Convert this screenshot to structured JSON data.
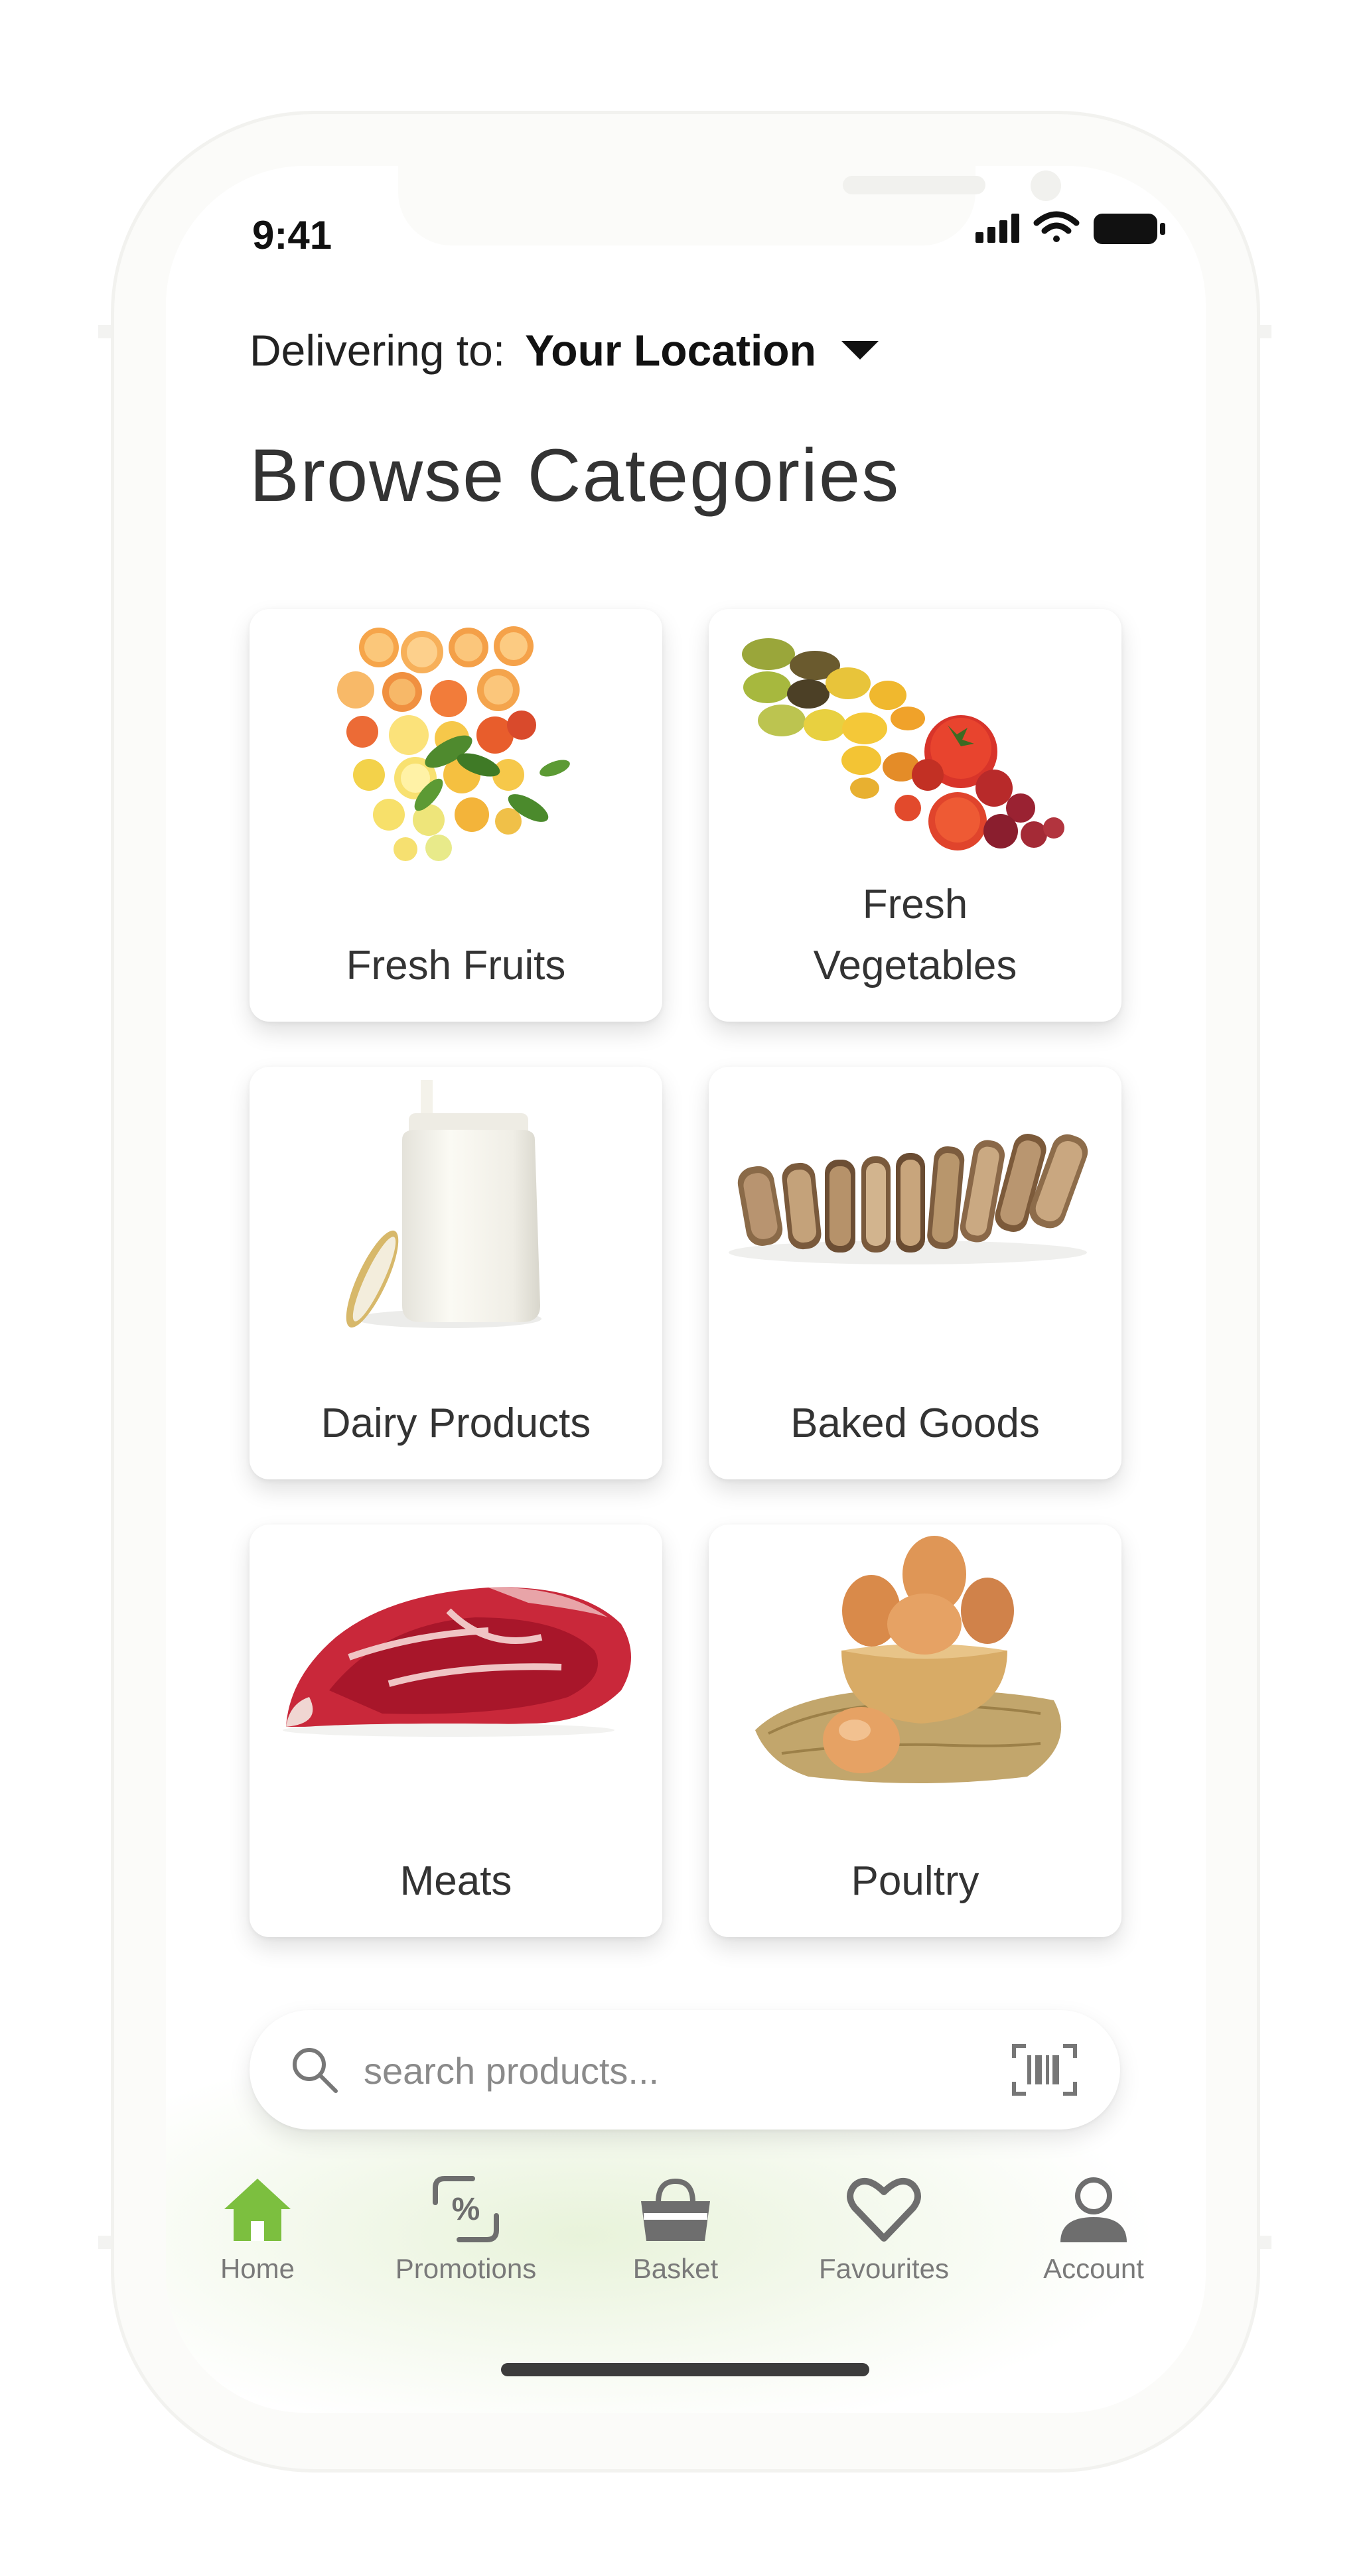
{
  "status_bar": {
    "time": "9:41"
  },
  "delivery": {
    "prefix": "Delivering to:",
    "location": "Your Location"
  },
  "page_title": "Browse Categories",
  "categories": [
    {
      "label": "Fresh Fruits",
      "icon": "citrus-fruits-image"
    },
    {
      "label": "Fresh\nVegetables",
      "icon": "tomatoes-vegetables-image"
    },
    {
      "label": "Dairy Products",
      "icon": "milk-jar-image"
    },
    {
      "label": "Baked Goods",
      "icon": "bread-loaf-image"
    },
    {
      "label": "Meats",
      "icon": "beef-steak-image"
    },
    {
      "label": "Poultry",
      "icon": "eggs-bowl-image"
    }
  ],
  "search": {
    "placeholder": "search products..."
  },
  "nav": {
    "items": [
      {
        "label": "Home",
        "icon": "home-icon",
        "active": true
      },
      {
        "label": "Promotions",
        "icon": "promotions-icon"
      },
      {
        "label": "Basket",
        "icon": "basket-icon"
      },
      {
        "label": "Favourites",
        "icon": "heart-icon"
      },
      {
        "label": "Account",
        "icon": "account-icon"
      }
    ]
  },
  "colors": {
    "accent": "#7cbf3f",
    "nav_inactive": "#6e6e6e"
  }
}
